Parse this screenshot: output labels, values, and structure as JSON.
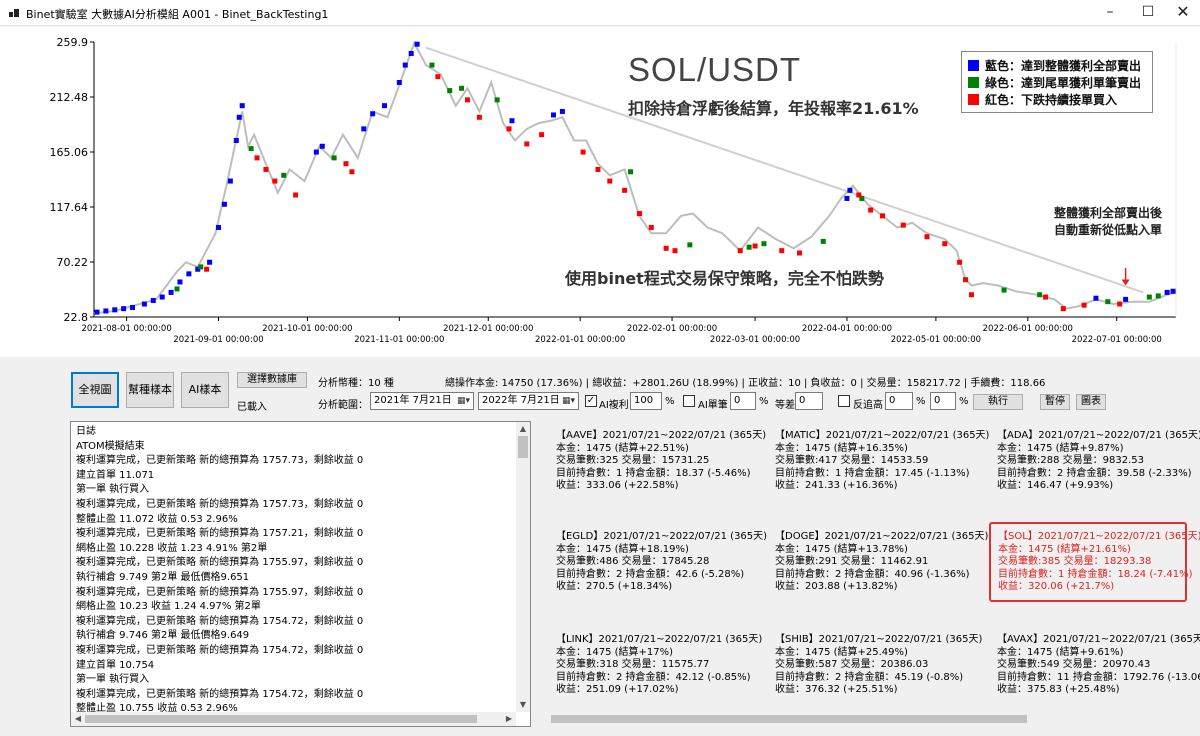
{
  "window": {
    "title": "Binet實驗室  大數據AI分析模組 A001 - Binet_BackTesting1",
    "minimize_icon": "minimize-icon",
    "maximize_icon": "maximize-icon",
    "close_icon": "close-icon"
  },
  "chart_data": {
    "type": "line",
    "title": "SOL/USDT",
    "subtitle": "扣除持倉浮虧後結算，年投報率21.61%",
    "annotation_main": "使用binet程式交易保守策略，完全不怕跌勢",
    "annotation_note": [
      "整體獲利全部賣出後",
      "自動重新從低點入單"
    ],
    "ylim": [
      22.8,
      259.9
    ],
    "y_ticks": [
      "259.9",
      "212.48",
      "165.06",
      "117.64",
      "70.22",
      "22.8"
    ],
    "x_ticks_upper": [
      "2021-08-01 00:00:00",
      "2021-10-01 00:00:00",
      "2021-12-01 00:00:00",
      "2022-02-01 00:00:00",
      "2022-04-01 00:00:00",
      "2022-06-01 00:00:00"
    ],
    "x_ticks_lower": [
      "2021-09-01 00:00:00",
      "2021-11-01 00:00:00",
      "2022-01-01 00:00:00",
      "2022-03-01 00:00:00",
      "2022-05-01 00:00:00",
      "2022-07-01 00:00:00"
    ],
    "x_start": "2021-07-21",
    "x_end": "2022-07-21",
    "series": [
      {
        "color": "#bdbdbd",
        "points": [
          [
            "2021-07-21",
            26
          ],
          [
            "2021-07-28",
            28
          ],
          [
            "2021-08-04",
            33
          ],
          [
            "2021-08-11",
            38
          ],
          [
            "2021-08-18",
            62
          ],
          [
            "2021-08-21",
            70
          ],
          [
            "2021-08-25",
            66
          ],
          [
            "2021-08-31",
            95
          ],
          [
            "2021-09-04",
            140
          ],
          [
            "2021-09-09",
            200
          ],
          [
            "2021-09-11",
            170
          ],
          [
            "2021-09-13",
            180
          ],
          [
            "2021-09-17",
            155
          ],
          [
            "2021-09-21",
            130
          ],
          [
            "2021-09-25",
            150
          ],
          [
            "2021-09-30",
            140
          ],
          [
            "2021-10-05",
            170
          ],
          [
            "2021-10-09",
            160
          ],
          [
            "2021-10-13",
            180
          ],
          [
            "2021-10-18",
            160
          ],
          [
            "2021-10-23",
            200
          ],
          [
            "2021-10-28",
            195
          ],
          [
            "2021-11-02",
            230
          ],
          [
            "2021-11-06",
            259
          ],
          [
            "2021-11-10",
            240
          ],
          [
            "2021-11-15",
            232
          ],
          [
            "2021-11-20",
            205
          ],
          [
            "2021-11-24",
            220
          ],
          [
            "2021-11-28",
            200
          ],
          [
            "2021-12-02",
            225
          ],
          [
            "2021-12-06",
            190
          ],
          [
            "2021-12-10",
            175
          ],
          [
            "2021-12-14",
            185
          ],
          [
            "2021-12-18",
            190
          ],
          [
            "2021-12-22",
            192
          ],
          [
            "2021-12-26",
            195
          ],
          [
            "2021-12-30",
            175
          ],
          [
            "2022-01-03",
            175
          ],
          [
            "2022-01-07",
            155
          ],
          [
            "2022-01-11",
            145
          ],
          [
            "2022-01-16",
            150
          ],
          [
            "2022-01-21",
            110
          ],
          [
            "2022-01-25",
            95
          ],
          [
            "2022-01-30",
            95
          ],
          [
            "2022-02-04",
            110
          ],
          [
            "2022-02-08",
            112
          ],
          [
            "2022-02-13",
            100
          ],
          [
            "2022-02-18",
            95
          ],
          [
            "2022-02-24",
            80
          ],
          [
            "2022-03-02",
            100
          ],
          [
            "2022-03-08",
            90
          ],
          [
            "2022-03-14",
            82
          ],
          [
            "2022-03-20",
            92
          ],
          [
            "2022-03-26",
            110
          ],
          [
            "2022-03-30",
            125
          ],
          [
            "2022-04-03",
            136
          ],
          [
            "2022-04-08",
            120
          ],
          [
            "2022-04-13",
            110
          ],
          [
            "2022-04-18",
            100
          ],
          [
            "2022-04-23",
            104
          ],
          [
            "2022-04-28",
            95
          ],
          [
            "2022-05-04",
            90
          ],
          [
            "2022-05-08",
            80
          ],
          [
            "2022-05-11",
            55
          ],
          [
            "2022-05-13",
            50
          ],
          [
            "2022-05-17",
            52
          ],
          [
            "2022-05-22",
            50
          ],
          [
            "2022-05-28",
            45
          ],
          [
            "2022-06-04",
            42
          ],
          [
            "2022-06-10",
            38
          ],
          [
            "2022-06-14",
            30
          ],
          [
            "2022-06-18",
            32
          ],
          [
            "2022-06-24",
            38
          ],
          [
            "2022-06-30",
            34
          ],
          [
            "2022-07-06",
            36
          ],
          [
            "2022-07-12",
            36
          ],
          [
            "2022-07-18",
            42
          ],
          [
            "2022-07-21",
            44
          ]
        ]
      }
    ],
    "trend_line": [
      [
        "2021-11-10",
        255
      ],
      [
        "2022-07-10",
        44
      ]
    ],
    "arrow": {
      "date": "2022-07-04",
      "from": 65,
      "to": 50,
      "color": "#e02020"
    },
    "markers": {
      "blue": [
        [
          "2021-07-22",
          27
        ],
        [
          "2021-07-25",
          28
        ],
        [
          "2021-07-28",
          29
        ],
        [
          "2021-07-31",
          30
        ],
        [
          "2021-08-03",
          31
        ],
        [
          "2021-08-07",
          34
        ],
        [
          "2021-08-10",
          37
        ],
        [
          "2021-08-13",
          40
        ],
        [
          "2021-08-16",
          44
        ],
        [
          "2021-08-19",
          53
        ],
        [
          "2021-08-22",
          60
        ],
        [
          "2021-08-25",
          64
        ],
        [
          "2021-08-29",
          70
        ],
        [
          "2021-09-01",
          100
        ],
        [
          "2021-09-03",
          120
        ],
        [
          "2021-09-05",
          140
        ],
        [
          "2021-09-07",
          175
        ],
        [
          "2021-09-08",
          195
        ],
        [
          "2021-09-09",
          205
        ],
        [
          "2021-10-04",
          165
        ],
        [
          "2021-10-06",
          170
        ],
        [
          "2021-10-20",
          185
        ],
        [
          "2021-10-23",
          198
        ],
        [
          "2021-10-27",
          205
        ],
        [
          "2021-11-01",
          225
        ],
        [
          "2021-11-03",
          240
        ],
        [
          "2021-11-05",
          250
        ],
        [
          "2021-11-07",
          258
        ],
        [
          "2021-12-09",
          192
        ],
        [
          "2021-12-23",
          197
        ],
        [
          "2021-12-26",
          200
        ],
        [
          "2022-04-02",
          132
        ],
        [
          "2022-04-01",
          125
        ],
        [
          "2022-06-24",
          39
        ],
        [
          "2022-07-04",
          38
        ],
        [
          "2022-07-18",
          44
        ],
        [
          "2022-07-20",
          45
        ]
      ],
      "green": [
        [
          "2021-08-18",
          47
        ],
        [
          "2021-08-26",
          66
        ],
        [
          "2021-09-12",
          168
        ],
        [
          "2021-09-23",
          145
        ],
        [
          "2021-10-10",
          160
        ],
        [
          "2021-11-12",
          240
        ],
        [
          "2021-11-18",
          218
        ],
        [
          "2021-11-22",
          220
        ],
        [
          "2021-12-04",
          210
        ],
        [
          "2022-01-18",
          148
        ],
        [
          "2022-02-07",
          85
        ],
        [
          "2022-02-27",
          83
        ],
        [
          "2022-03-04",
          86
        ],
        [
          "2022-03-24",
          88
        ],
        [
          "2022-04-06",
          125
        ],
        [
          "2022-05-24",
          46
        ],
        [
          "2022-06-05",
          42
        ],
        [
          "2022-06-28",
          36
        ],
        [
          "2022-07-12",
          40
        ],
        [
          "2022-07-15",
          41
        ]
      ],
      "red": [
        [
          "2021-08-28",
          64
        ],
        [
          "2021-09-14",
          160
        ],
        [
          "2021-09-17",
          150
        ],
        [
          "2021-09-20",
          140
        ],
        [
          "2021-09-27",
          128
        ],
        [
          "2021-10-14",
          155
        ],
        [
          "2021-10-16",
          148
        ],
        [
          "2021-11-14",
          230
        ],
        [
          "2021-11-24",
          210
        ],
        [
          "2021-11-28",
          195
        ],
        [
          "2021-12-08",
          185
        ],
        [
          "2021-12-14",
          172
        ],
        [
          "2021-12-19",
          180
        ],
        [
          "2022-01-02",
          165
        ],
        [
          "2022-01-07",
          150
        ],
        [
          "2022-01-11",
          140
        ],
        [
          "2022-01-16",
          132
        ],
        [
          "2022-01-21",
          112
        ],
        [
          "2022-01-25",
          100
        ],
        [
          "2022-01-30",
          82
        ],
        [
          "2022-02-02",
          80
        ],
        [
          "2022-02-24",
          80
        ],
        [
          "2022-03-01",
          84
        ],
        [
          "2022-03-10",
          80
        ],
        [
          "2022-03-16",
          78
        ],
        [
          "2022-04-05",
          128
        ],
        [
          "2022-04-09",
          115
        ],
        [
          "2022-04-13",
          110
        ],
        [
          "2022-04-20",
          102
        ],
        [
          "2022-04-28",
          92
        ],
        [
          "2022-05-04",
          86
        ],
        [
          "2022-05-09",
          70
        ],
        [
          "2022-05-11",
          55
        ],
        [
          "2022-05-13",
          42
        ],
        [
          "2022-06-07",
          40
        ],
        [
          "2022-06-13",
          30
        ],
        [
          "2022-06-20",
          33
        ],
        [
          "2022-07-02",
          34
        ]
      ]
    },
    "legend": [
      {
        "color": "#0000ff",
        "label": "藍色：達到整體獲利全部賣出"
      },
      {
        "color": "#008000",
        "label": "綠色：達到尾單獲利單筆賣出"
      },
      {
        "color": "#ff0000",
        "label": "紅色：下跌持續接單買入"
      }
    ]
  },
  "controls": {
    "btn_full": "全視圖",
    "btn_help": "幫種樣本",
    "btn_ai": "AI樣本",
    "btn_select_data": "選擇數據庫",
    "status_loaded": "已載入",
    "analysis_count": "分析幣種：10 種",
    "summary": "總操作本金: 14750 (17.36%) | 總收益：+2801.26U (18.99%) | 正收益：10 | 負收益：0 | 交易量：158217.72 | 手續費：118.66",
    "range_label": "分析範圍：",
    "date_from": "2021年  7月21日",
    "date_to": "2022年  7月21日",
    "cal_icon": "calendar-icon",
    "ai_compound_label": "AI複利",
    "ai_compound_checked": true,
    "ai_compound_value": "100",
    "pct": "%",
    "ai_single_label": "AI單筆",
    "ai_single_value": "0",
    "equal_diff_label": "等差",
    "equal_diff_value": "0",
    "reverse_label": "反追高",
    "reverse_value1": "0",
    "reverse_value2": "0",
    "btn_execute": "執行",
    "btn_pause": "暫停",
    "btn_chart": "圖表"
  },
  "log": {
    "lines": [
      "日誌",
      "ATOM模擬結束",
      "複利運算完成，已更新策略 新的總預算為 1757.73，剩餘收益 0",
      "建立首單 11.071",
      "第一單 執行買入",
      "複利運算完成，已更新策略 新的總預算為 1757.73，剩餘收益 0",
      "整體止盈 11.072 收益 0.53  2.96%",
      "複利運算完成，已更新策略 新的總預算為 1757.21，剩餘收益 0",
      "網格止盈 10.228 收益 1.23 4.91% 第2單",
      "複利運算完成，已更新策略 新的總預算為 1755.97，剩餘收益 0",
      "執行補倉 9.749 第2單 最低價格9.651",
      "複利運算完成，已更新策略 新的總預算為 1755.97，剩餘收益 0",
      "網格止盈 10.23 收益 1.24 4.97% 第2單",
      "複利運算完成，已更新策略 新的總預算為 1754.72，剩餘收益 0",
      "執行補倉 9.746 第2單 最低價格9.649",
      "複利運算完成，已更新策略 新的總預算為 1754.72，剩餘收益 0",
      "建立首單 10.754",
      "第一單 執行買入",
      "複利運算完成，已更新策略 新的總預算為 1754.72，剩餘收益 0",
      "整體止盈 10.755 收益 0.53  2.96%"
    ]
  },
  "coins": [
    {
      "lines": [
        "【AAVE】2021/07/21~2022/07/21 (365天)",
        "本金：1475 (結算+22.51%)",
        "交易筆數:325  交易量：15731.25",
        "目前持倉數：1  持倉金額：18.37 (-5.46%)",
        "收益：333.06 (+22.58%)"
      ]
    },
    {
      "lines": [
        "【MATIC】2021/07/21~2022/07/21 (365天)",
        "本金：1475 (結算+16.35%)",
        "交易筆數:417  交易量：14533.59",
        "目前持倉數：1  持倉金額：17.45 (-1.13%)",
        "收益：241.33 (+16.36%)"
      ]
    },
    {
      "lines": [
        "【ADA】2021/07/21~2022/07/21 (365天)",
        "本金：1475 (結算+9.87%)",
        "交易筆數:288  交易量：9832.53",
        "目前持倉數：2  持倉金額：39.58 (-2.33%)",
        "收益：146.47 (+9.93%)"
      ]
    },
    {
      "lines": [
        "【EGLD】2021/07/21~2022/07/21 (365天)",
        "本金：1475 (結算+18.19%)",
        "交易筆數:486  交易量：17845.28",
        "目前持倉數：2  持倉金額：42.6 (-5.28%)",
        "收益：270.5 (+18.34%)"
      ]
    },
    {
      "lines": [
        "【DOGE】2021/07/21~2022/07/21 (365天)",
        "本金：1475 (結算+13.78%)",
        "交易筆數:291  交易量：11462.91",
        "目前持倉數：2  持倉金額：40.96 (-1.36%)",
        "收益：203.88 (+13.82%)"
      ]
    },
    {
      "lines": [
        "【SOL】2021/07/21~2022/07/21 (365天)",
        "本金：1475 (結算+21.61%)",
        "交易筆數:385  交易量：18293.38",
        "目前持倉數：1  持倉金額：18.24 (-7.41%)",
        "收益：320.06 (+21.7%)"
      ],
      "highlight": true
    },
    {
      "lines": [
        "【LINK】2021/07/21~2022/07/21 (365天)",
        "本金：1475 (結算+17%)",
        "交易筆數:318  交易量：11575.77",
        "目前持倉數：2  持倉金額：42.12 (-0.85%)",
        "收益：251.09 (+17.02%)"
      ]
    },
    {
      "lines": [
        "【SHIB】2021/07/21~2022/07/21 (365天)",
        "本金：1475 (結算+25.49%)",
        "交易筆數:587  交易量：20386.03",
        "目前持倉數：2  持倉金額：45.19 (-0.8%)",
        "收益：376.32 (+25.51%)"
      ]
    },
    {
      "lines": [
        "【AVAX】2021/07/21~2022/07/21 (365天)",
        "本金：1475 (結算+9.61%)",
        "交易筆數:549  交易量：20970.43",
        "目前持倉數：11  持倉金額：1792.76 (-13.06%)",
        "收益：375.83 (+25.48%)"
      ]
    }
  ]
}
